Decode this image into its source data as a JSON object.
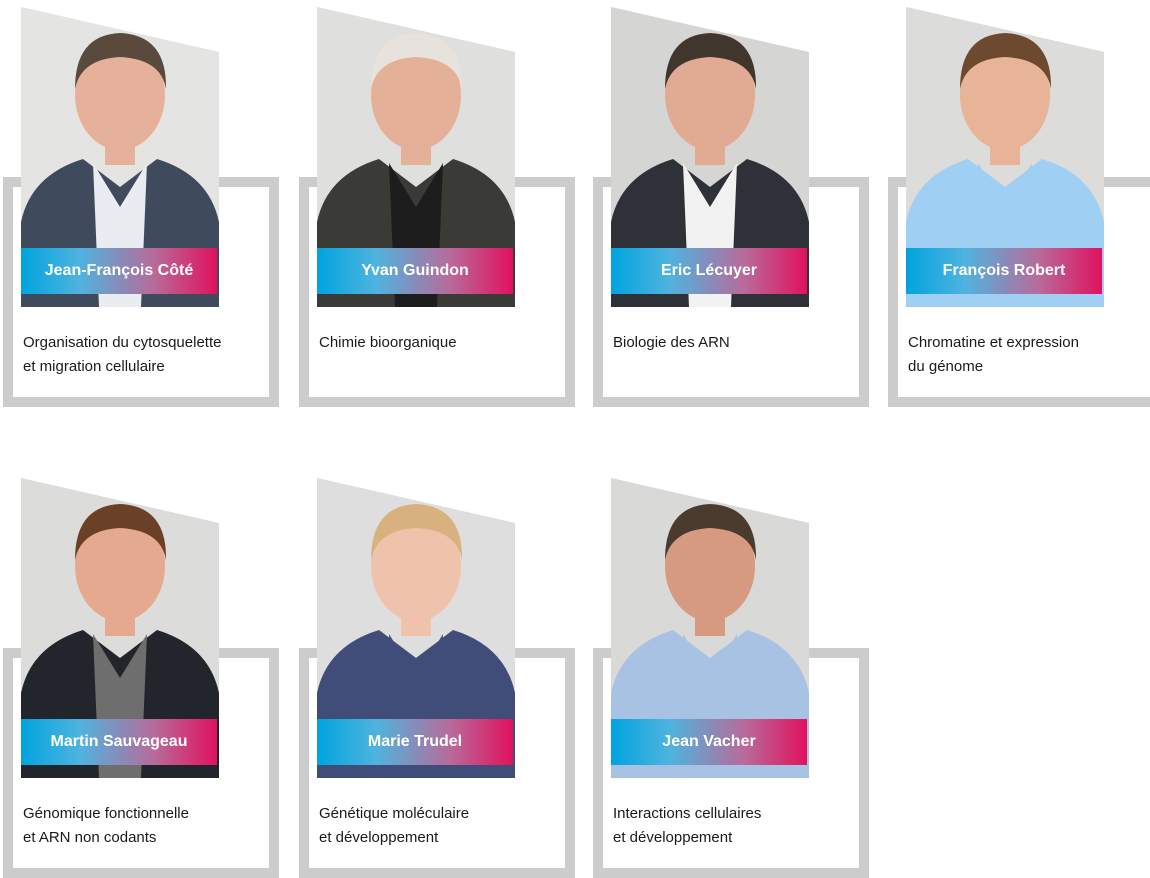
{
  "people": [
    {
      "name": "Jean-François Côté",
      "topic_line1": "Organisation du cytosquelette",
      "topic_line2": "et migration cellulaire",
      "colors": {
        "bg": "#e4e4e2",
        "hair": "#5a4a3e",
        "skin": "#e6b19a",
        "shirt": "#e9edf2",
        "jacket": "#3f4a5c"
      }
    },
    {
      "name": "Yvan Guindon",
      "topic_line1": "Chimie bioorganique",
      "topic_line2": "",
      "colors": {
        "bg": "#dfdfdd",
        "hair": "#e7e3dc",
        "skin": "#e5b098",
        "shirt": "#1d1d1d",
        "jacket": "#3a3a36"
      }
    },
    {
      "name": "Eric Lécuyer",
      "topic_line1": "Biologie des ARN",
      "topic_line2": "",
      "colors": {
        "bg": "#d5d5d3",
        "hair": "#41362d",
        "skin": "#e0ab92",
        "shirt": "#f2f2f2",
        "jacket": "#2e3238"
      }
    },
    {
      "name": "François Robert",
      "topic_line1": "Chromatine et expression",
      "topic_line2": "du génome",
      "colors": {
        "bg": "#dcdcda",
        "hair": "#6d4a2f",
        "skin": "#e8b497",
        "shirt": "#9fcff2",
        "jacket": "#9fcff2"
      }
    },
    {
      "name": "Martin Sauvageau",
      "topic_line1": "Génomique fonctionnelle",
      "topic_line2": "et ARN non codants",
      "colors": {
        "bg": "#dcdcda",
        "hair": "#6a4026",
        "skin": "#e4a98e",
        "shirt": "#6e6e6e",
        "jacket": "#22252b"
      }
    },
    {
      "name": "Marie Trudel",
      "topic_line1": "Génétique moléculaire",
      "topic_line2": "et développement",
      "colors": {
        "bg": "#dedede",
        "hair": "#d8b27e",
        "skin": "#eec2ab",
        "shirt": "#3f4d78",
        "jacket": "#3f4d78"
      }
    },
    {
      "name": "Jean Vacher",
      "topic_line1": "Interactions cellulaires",
      "topic_line2": "et développement",
      "colors": {
        "bg": "#d9d9d7",
        "hair": "#4b3a2e",
        "skin": "#d69a80",
        "shirt": "#a8c2e4",
        "jacket": "#a8c2e4"
      }
    }
  ]
}
